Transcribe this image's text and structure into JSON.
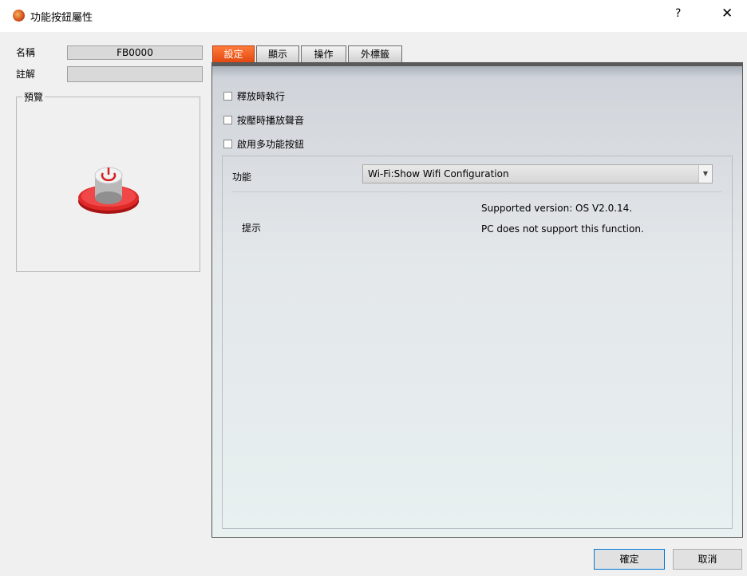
{
  "window": {
    "title": "功能按鈕屬性",
    "help": "?",
    "close": "✕"
  },
  "props": {
    "name_label": "名稱",
    "name_value": "FB0000",
    "comment_label": "註解",
    "comment_value": "",
    "preview_label": "預覽"
  },
  "tabs": [
    {
      "label": "設定",
      "active": true
    },
    {
      "label": "顯示",
      "active": false
    },
    {
      "label": "操作",
      "active": false
    },
    {
      "label": "外標籤",
      "active": false
    }
  ],
  "settings": {
    "checkboxes": [
      {
        "label": "釋放時執行",
        "checked": false
      },
      {
        "label": "按壓時播放聲音",
        "checked": false
      },
      {
        "label": "啟用多功能按鈕",
        "checked": false
      }
    ],
    "function_label": "功能",
    "function_value": "Wi-Fi:Show Wifi Configuration",
    "hint_label": "提示",
    "hint_lines": [
      "Supported version: OS V2.0.14.",
      "PC does not support this function."
    ]
  },
  "buttons": {
    "ok": "確定",
    "cancel": "取消"
  },
  "colors": {
    "active_tab": "#e8561a",
    "power_button": "#d42121"
  }
}
